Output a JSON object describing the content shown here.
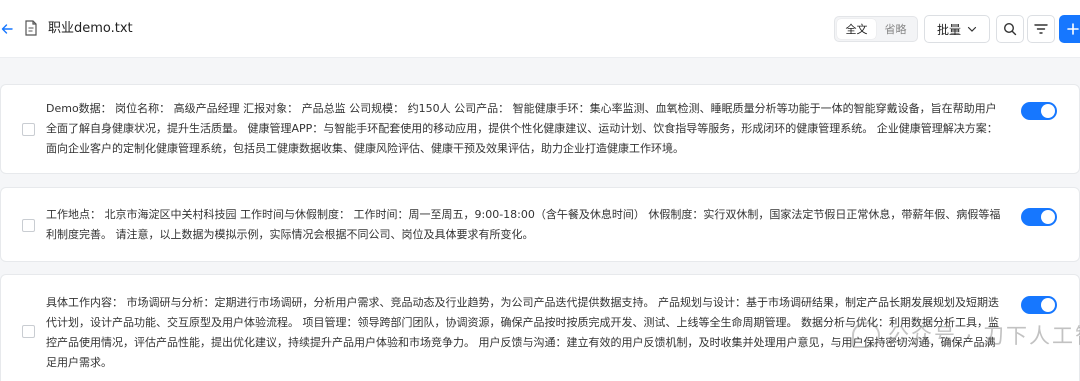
{
  "header": {
    "file_name": "职业demo.txt",
    "view_modes": {
      "full": "全文",
      "omit": "省略"
    },
    "batch_label": "批量"
  },
  "cards": [
    {
      "text": "Demo数据：  岗位名称：  高级产品经理 汇报对象：  产品总监 公司规模：  约150人 公司产品：  智能健康手环：集心率监测、血氧检测、睡眠质量分析等功能于一体的智能穿戴设备，旨在帮助用户全面了解自身健康状况，提升生活质量。  健康管理APP：与智能手环配套使用的移动应用，提供个性化健康建议、运动计划、饮食指导等服务，形成闭环的健康管理系统。  企业健康管理解决方案：面向企业客户的定制化健康管理系统，包括员工健康数据收集、健康风险评估、健康干预及效果评估，助力企业打造健康工作环境。"
    },
    {
      "text": "工作地点：  北京市海淀区中关村科技园 工作时间与休假制度：  工作时间：周一至周五，9:00-18:00（含午餐及休息时间）  休假制度：实行双休制，国家法定节假日正常休息，带薪年假、病假等福利制度完善。  请注意，以上数据为模拟示例，实际情况会根据不同公司、岗位及具体要求有所变化。"
    },
    {
      "text": "具体工作内容：  市场调研与分析：定期进行市场调研，分析用户需求、竞品动态及行业趋势，为公司产品迭代提供数据支持。  产品规划与设计：基于市场调研结果，制定产品长期发展规划及短期迭代计划，设计产品功能、交互原型及用户体验流程。  项目管理：领导跨部门团队，协调资源，确保产品按时按质完成开发、测试、上线等全生命周期管理。  数据分析与优化：利用数据分析工具，监控产品使用情况，评估产品性能，提出优化建议，持续提升产品用户体验和市场竞争力。  用户反馈与沟通：建立有效的用户反馈机制，及时收集并处理用户意见，与用户保持密切沟通，确保产品满足用户需求。"
    }
  ],
  "watermark": "公众号 · 刀下人工智能",
  "colors": {
    "accent": "#1677ff"
  },
  "icons": {
    "back": "arrow-left-icon",
    "file": "text-file-icon",
    "search": "search-icon",
    "filter": "filter-icon",
    "add": "plus-icon",
    "chevron": "chevron-down-icon"
  }
}
